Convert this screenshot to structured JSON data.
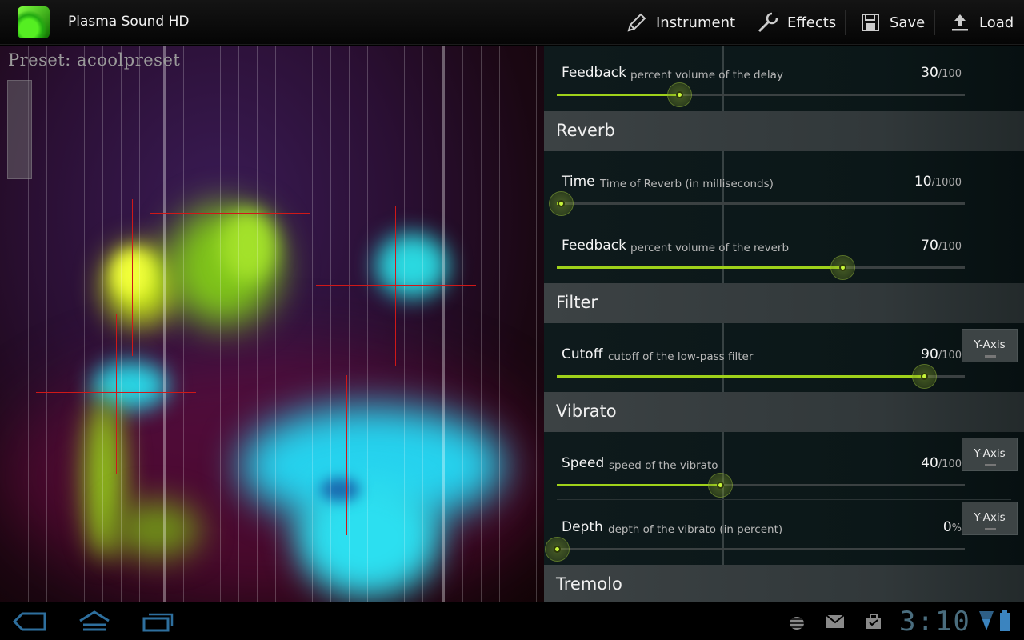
{
  "app": {
    "title": "Plasma Sound HD"
  },
  "actionbar": {
    "instrument_label": "Instrument",
    "effects_label": "Effects",
    "save_label": "Save",
    "load_label": "Load"
  },
  "plasma": {
    "preset_label": "Preset: acoolpreset"
  },
  "settings": {
    "delay_feedback": {
      "name": "Feedback",
      "desc": "percent volume of the delay",
      "value": "30",
      "unit": "/100",
      "level": 0.3
    },
    "reverb": {
      "title": "Reverb",
      "time": {
        "name": "Time",
        "desc": "Time of Reverb (in milliseconds)",
        "value": "10",
        "unit": "/1000",
        "level": 0.01
      },
      "feedback": {
        "name": "Feedback",
        "desc": "percent volume of the reverb",
        "value": "70",
        "unit": "/100",
        "level": 0.7
      }
    },
    "filter": {
      "title": "Filter",
      "cutoff": {
        "name": "Cutoff",
        "desc": "cutoff of the low-pass filter",
        "value": "90",
        "unit": "/100",
        "level": 0.9,
        "axis_button": "Y-Axis"
      }
    },
    "vibrato": {
      "title": "Vibrato",
      "speed": {
        "name": "Speed",
        "desc": "speed of the vibrato",
        "value": "40",
        "unit": "/100",
        "level": 0.4,
        "axis_button": "Y-Axis"
      },
      "depth": {
        "name": "Depth",
        "desc": "depth of the vibrato (in percent)",
        "value": "0",
        "unit": "%",
        "level": 0.0,
        "axis_button": "Y-Axis"
      }
    },
    "tremolo": {
      "title": "Tremolo"
    }
  },
  "system": {
    "clock": "3:10"
  },
  "colors": {
    "accent": "#9fd11a",
    "crosshair": "#d01818",
    "clock": "#4a6d7e"
  },
  "icons": [
    "pen-icon",
    "wrench-icon",
    "save-icon",
    "upload-icon",
    "back-icon",
    "home-icon",
    "recent-apps-icon",
    "android-icon",
    "mail-icon",
    "market-icon",
    "wifi-icon",
    "battery-icon"
  ]
}
